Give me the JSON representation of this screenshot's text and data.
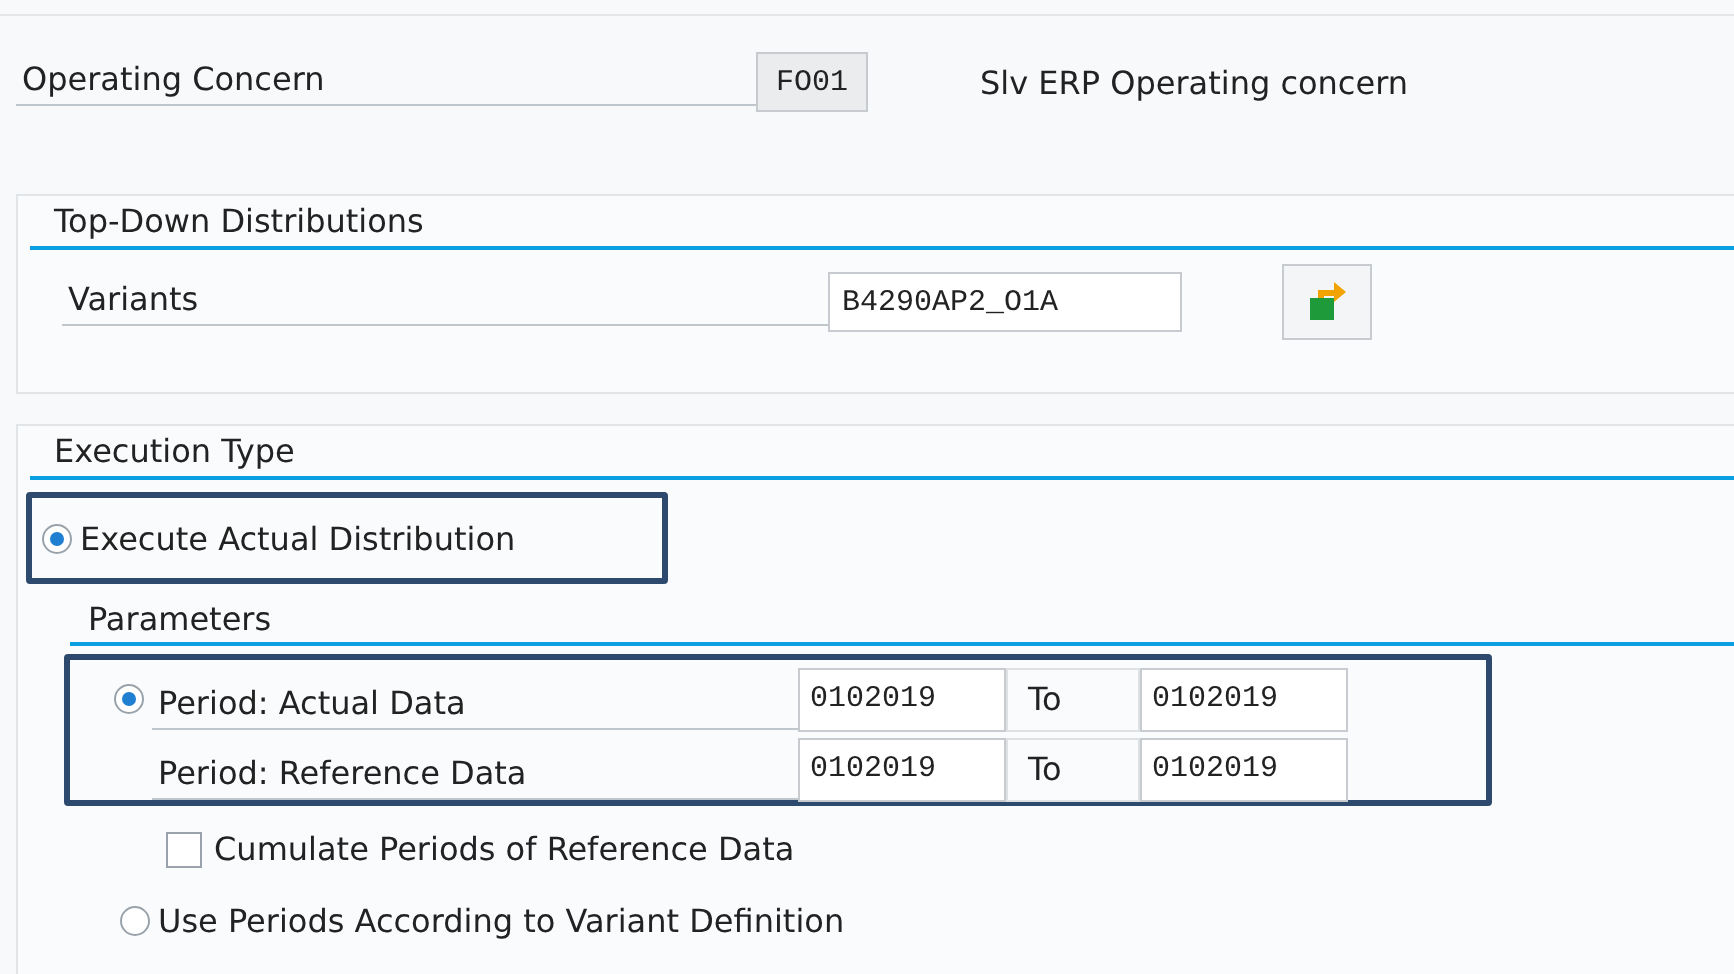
{
  "operating_concern": {
    "label": "Operating Concern",
    "value": "FO01",
    "description": "Slv ERP Operating concern"
  },
  "top_down": {
    "title": "Top-Down Distributions",
    "variants_label": "Variants",
    "variants_value": "B4290AP2_O1A"
  },
  "execution_type": {
    "title": "Execution Type",
    "actual_distribution": {
      "label": "Execute Actual Distribution",
      "selected": true
    },
    "parameters": {
      "title": "Parameters",
      "periods": [
        {
          "kind": "radio",
          "label": "Period: Actual Data",
          "selected": true,
          "from": "0102019",
          "to_label": "To",
          "to": "0102019"
        },
        {
          "kind": "plain",
          "label": "Period: Reference Data",
          "from": "0102019",
          "to_label": "To",
          "to": "0102019"
        }
      ],
      "cumulate": {
        "label": "Cumulate Periods of Reference Data",
        "checked": false
      },
      "use_variant_periods": {
        "label": "Use Periods According to Variant Definition",
        "selected": false
      }
    }
  }
}
